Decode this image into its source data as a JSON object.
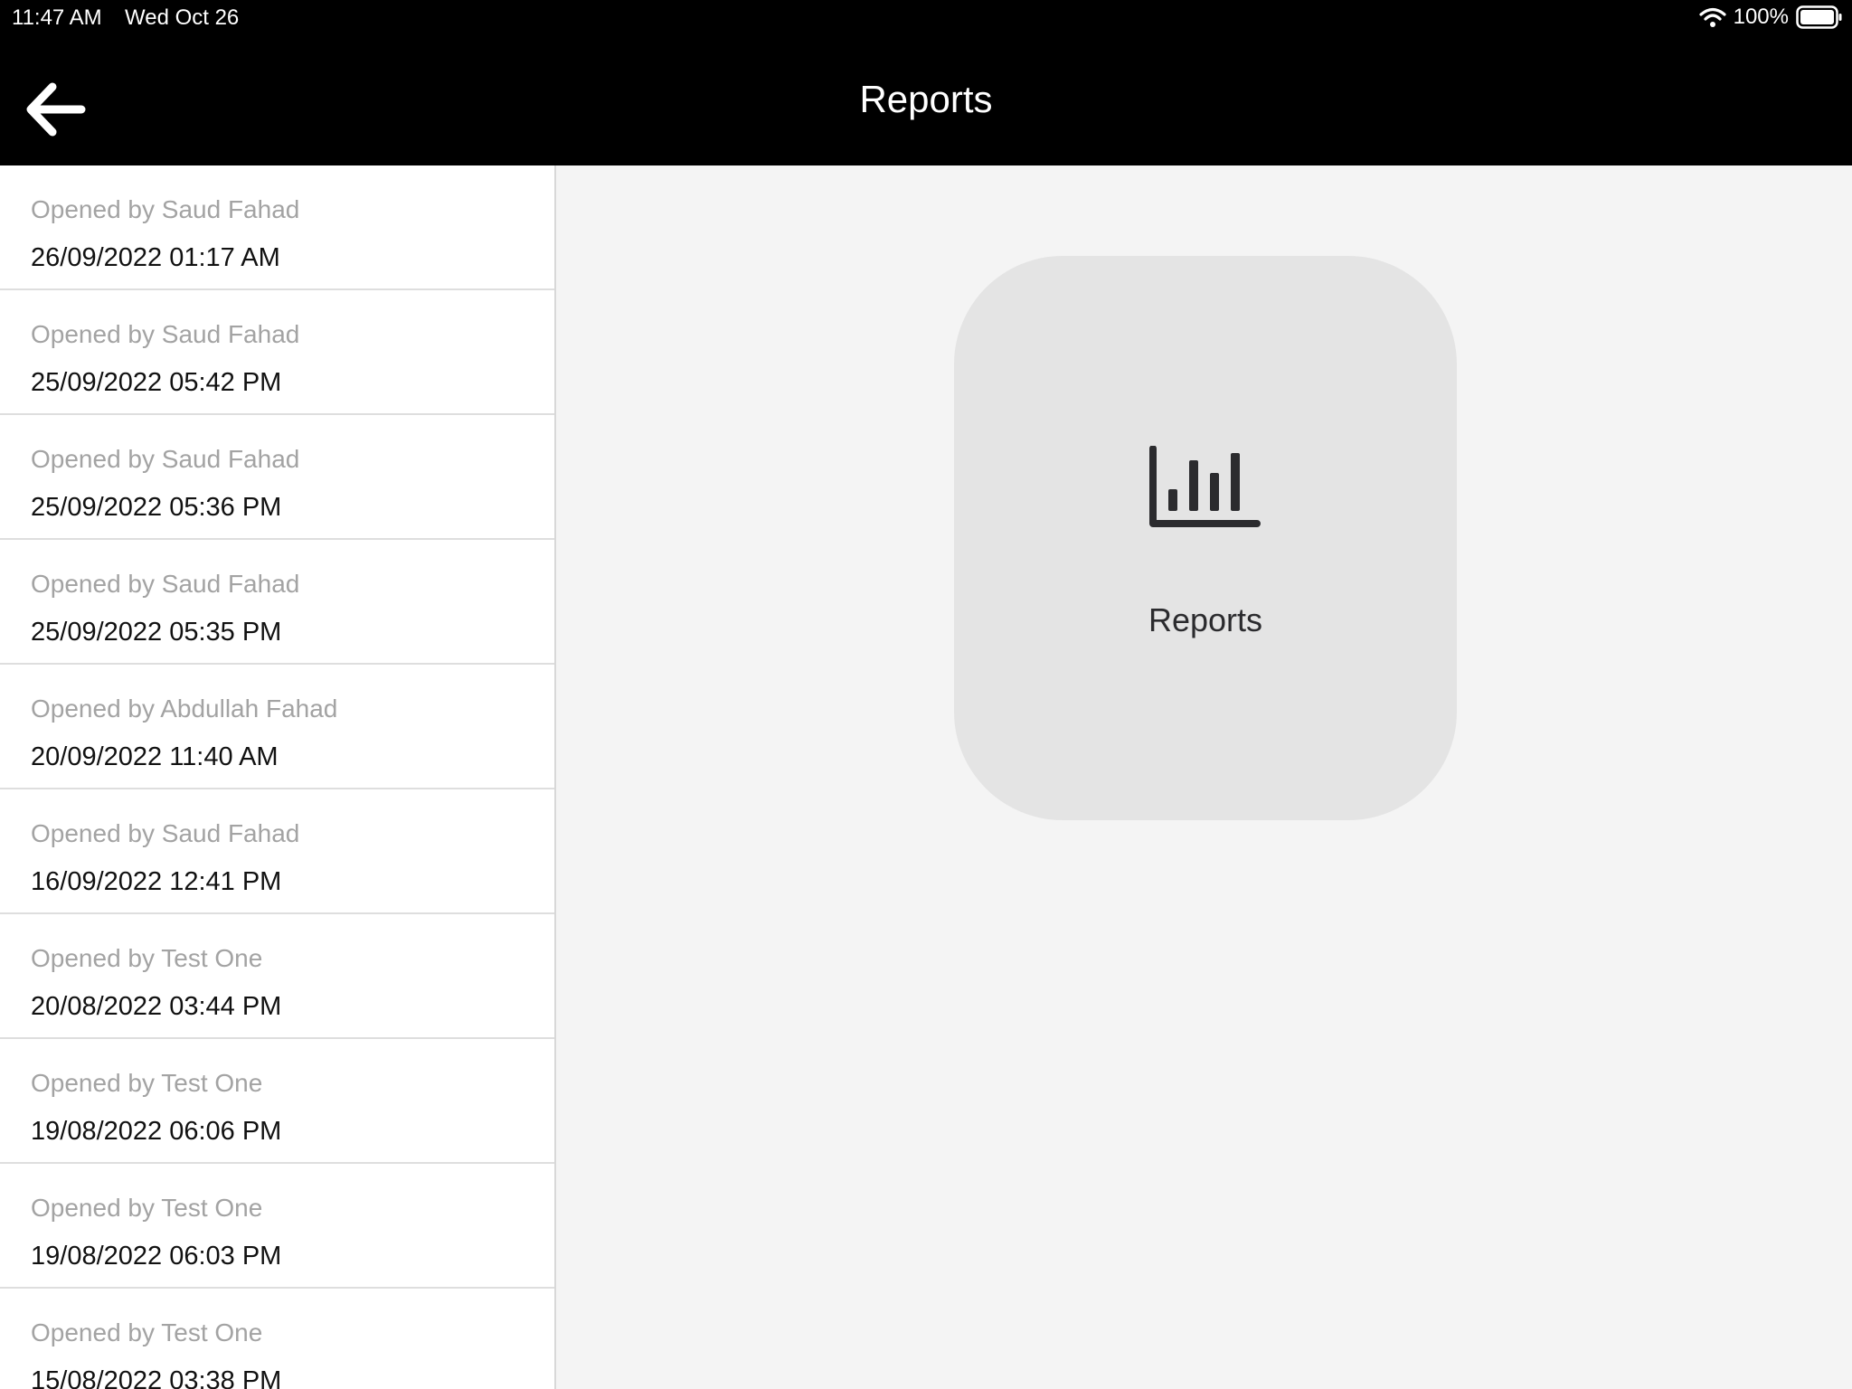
{
  "status_bar": {
    "time": "11:47 AM",
    "date": "Wed Oct 26",
    "battery_percent": "100%",
    "icons": [
      "wifi-icon",
      "battery-icon"
    ]
  },
  "nav": {
    "title": "Reports",
    "back_icon": "back-arrow-icon"
  },
  "sessions": [
    {
      "opened_by": "Opened by Saud Fahad",
      "datetime": "26/09/2022 01:17 AM"
    },
    {
      "opened_by": "Opened by Saud Fahad",
      "datetime": "25/09/2022 05:42 PM"
    },
    {
      "opened_by": "Opened by Saud Fahad",
      "datetime": "25/09/2022 05:36 PM"
    },
    {
      "opened_by": "Opened by Saud Fahad",
      "datetime": "25/09/2022 05:35 PM"
    },
    {
      "opened_by": "Opened by Abdullah Fahad",
      "datetime": "20/09/2022 11:40 AM"
    },
    {
      "opened_by": "Opened by Saud Fahad",
      "datetime": "16/09/2022 12:41 PM"
    },
    {
      "opened_by": "Opened by Test One",
      "datetime": "20/08/2022 03:44 PM"
    },
    {
      "opened_by": "Opened by Test One",
      "datetime": "19/08/2022 06:06 PM"
    },
    {
      "opened_by": "Opened by Test One",
      "datetime": "19/08/2022 06:03 PM"
    },
    {
      "opened_by": "Opened by Test One",
      "datetime": "15/08/2022 03:38 PM"
    }
  ],
  "main": {
    "reports_tile": {
      "label": "Reports",
      "icon": "bar-chart-icon"
    }
  },
  "colors": {
    "nav_background": "#000000",
    "main_background": "#f4f4f4",
    "tile_background": "#e4e4e4",
    "secondary_text": "#a3a3a3",
    "icon_color": "#2b2b2e"
  }
}
